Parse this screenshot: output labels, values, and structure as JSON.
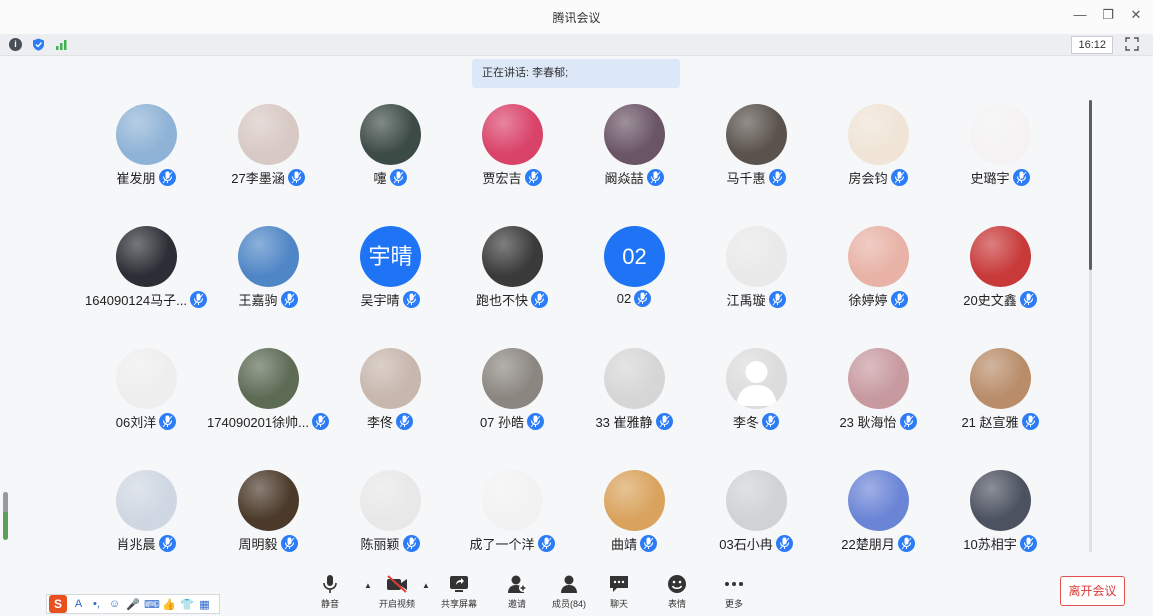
{
  "window": {
    "title": "腾讯会议"
  },
  "status": {
    "time": "16:12"
  },
  "speaking": {
    "text": "正在讲话: 李春郁;"
  },
  "participants": [
    {
      "name": "崔发朋",
      "avatar": "sky-photo",
      "bg": "#8fb3d6"
    },
    {
      "name": "27李墨涵",
      "avatar": "cartoon-girl",
      "bg": "#d8c9c4"
    },
    {
      "name": "嚏",
      "avatar": "anime-face",
      "bg": "#3d4b46"
    },
    {
      "name": "贾宏吉",
      "avatar": "red-ink-art",
      "bg": "#d9436a"
    },
    {
      "name": "阚焱喆",
      "avatar": "city-night",
      "bg": "#6a5566"
    },
    {
      "name": "马千惠",
      "avatar": "street-photo",
      "bg": "#5a524c"
    },
    {
      "name": "房会钧",
      "avatar": "cartoon-girl-suit",
      "bg": "#efe4d6"
    },
    {
      "name": "史璐宇",
      "avatar": "pink-dino",
      "bg": "#f4f2f2"
    },
    {
      "name": "164090124马子...",
      "avatar": "dark-portrait",
      "bg": "#2b2f35"
    },
    {
      "name": "王嘉驹",
      "avatar": "blue-sky-boy",
      "bg": "#4f86c6"
    },
    {
      "name": "吴宇晴",
      "avatar": "text",
      "text": "宇晴",
      "bg": "#1e74f5"
    },
    {
      "name": "跑也不快",
      "avatar": "techsize-logo",
      "bg": "#3a3a3a"
    },
    {
      "name": "02",
      "avatar": "text",
      "text": "02",
      "bg": "#1e74f5"
    },
    {
      "name": "江禹璇",
      "avatar": "sketch-boy",
      "bg": "#e9e9e9"
    },
    {
      "name": "徐婷婷",
      "avatar": "bear",
      "bg": "#e8b2a6"
    },
    {
      "name": "20史文鑫",
      "avatar": "mermaid",
      "bg": "#c83a3a"
    },
    {
      "name": "06刘洋",
      "avatar": "masked-man",
      "bg": "#eeeeee"
    },
    {
      "name": "174090201徐帅...",
      "avatar": "plants",
      "bg": "#5d6b55"
    },
    {
      "name": "李佟",
      "avatar": "girl-photo",
      "bg": "#c7b7ad"
    },
    {
      "name": "07 孙皓",
      "avatar": "mask-man",
      "bg": "#8b8680"
    },
    {
      "name": "33 崔雅静",
      "avatar": "bw-girl",
      "bg": "#d6d6d6"
    },
    {
      "name": "李冬",
      "avatar": "default",
      "bg": "#dcdcdc"
    },
    {
      "name": "23  耿海怡",
      "avatar": "pink-room",
      "bg": "#c79aa0"
    },
    {
      "name": "21 赵宣雅",
      "avatar": "girl-cafe",
      "bg": "#b98d6a"
    },
    {
      "name": "肖兆晨",
      "avatar": "couple-art",
      "bg": "#cfd7e2"
    },
    {
      "name": "周明毅",
      "avatar": "dark-tunnel",
      "bg": "#4b3a2a"
    },
    {
      "name": "陈丽颖",
      "avatar": "anime-boy",
      "bg": "#e8e8e8"
    },
    {
      "name": "成了一个洋",
      "avatar": "red-card",
      "bg": "#f2f2f2"
    },
    {
      "name": "曲靖",
      "avatar": "jerry",
      "bg": "#d9a35d"
    },
    {
      "name": "03石小冉",
      "avatar": "hand",
      "bg": "#cfd3d6"
    },
    {
      "name": "22楚朋月",
      "avatar": "blue-art",
      "bg": "#6b85d6"
    },
    {
      "name": "10苏相宇",
      "avatar": "anime-hood",
      "bg": "#4c5260"
    }
  ],
  "toolbar": {
    "mute": "静音",
    "video": "开启视频",
    "share": "共享屏幕",
    "invite": "邀请",
    "members": "成员(84)",
    "chat": "聊天",
    "emoji": "表情",
    "more": "更多",
    "leave": "离开会议"
  },
  "ime": {
    "logo": "S",
    "items": [
      "A",
      "•,",
      "☺",
      "🎤",
      "⌨",
      "👍",
      "👕",
      "▦"
    ]
  }
}
